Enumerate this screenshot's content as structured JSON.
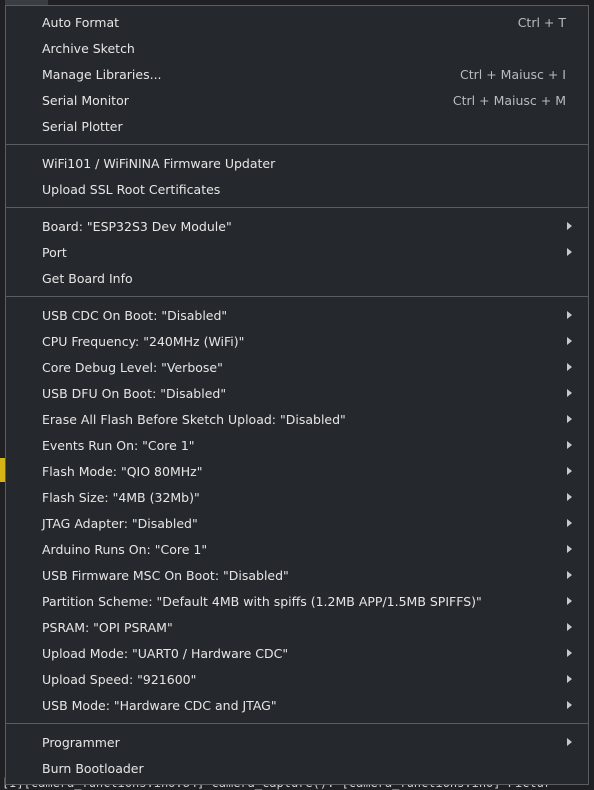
{
  "background": {
    "log_line": "[I][camera_functions.ino:84] camera_capture(): [camera_functions.ino] Pictur"
  },
  "menu": {
    "groups": [
      [
        {
          "label": "Auto Format",
          "shortcut": "Ctrl + T"
        },
        {
          "label": "Archive Sketch"
        },
        {
          "label": "Manage Libraries...",
          "shortcut": "Ctrl + Maiusc + I"
        },
        {
          "label": "Serial Monitor",
          "shortcut": "Ctrl + Maiusc + M"
        },
        {
          "label": "Serial Plotter"
        }
      ],
      [
        {
          "label": "WiFi101 / WiFiNINA Firmware Updater"
        },
        {
          "label": "Upload SSL Root Certificates"
        }
      ],
      [
        {
          "label": "Board: \"ESP32S3 Dev Module\"",
          "submenu": true
        },
        {
          "label": "Port",
          "submenu": true
        },
        {
          "label": "Get Board Info"
        }
      ],
      [
        {
          "label": "USB CDC On Boot: \"Disabled\"",
          "submenu": true
        },
        {
          "label": "CPU Frequency: \"240MHz (WiFi)\"",
          "submenu": true
        },
        {
          "label": "Core Debug Level: \"Verbose\"",
          "submenu": true
        },
        {
          "label": "USB DFU On Boot: \"Disabled\"",
          "submenu": true
        },
        {
          "label": "Erase All Flash Before Sketch Upload: \"Disabled\"",
          "submenu": true
        },
        {
          "label": "Events Run On: \"Core 1\"",
          "submenu": true
        },
        {
          "label": "Flash Mode: \"QIO 80MHz\"",
          "submenu": true
        },
        {
          "label": "Flash Size: \"4MB (32Mb)\"",
          "submenu": true
        },
        {
          "label": "JTAG Adapter: \"Disabled\"",
          "submenu": true
        },
        {
          "label": "Arduino Runs On: \"Core 1\"",
          "submenu": true
        },
        {
          "label": "USB Firmware MSC On Boot: \"Disabled\"",
          "submenu": true
        },
        {
          "label": "Partition Scheme: \"Default 4MB with spiffs (1.2MB APP/1.5MB SPIFFS)\"",
          "submenu": true
        },
        {
          "label": "PSRAM: \"OPI PSRAM\"",
          "submenu": true
        },
        {
          "label": "Upload Mode: \"UART0 / Hardware CDC\"",
          "submenu": true
        },
        {
          "label": "Upload Speed: \"921600\"",
          "submenu": true
        },
        {
          "label": "USB Mode: \"Hardware CDC and JTAG\"",
          "submenu": true
        }
      ],
      [
        {
          "label": "Programmer",
          "submenu": true
        },
        {
          "label": "Burn Bootloader"
        }
      ]
    ]
  }
}
